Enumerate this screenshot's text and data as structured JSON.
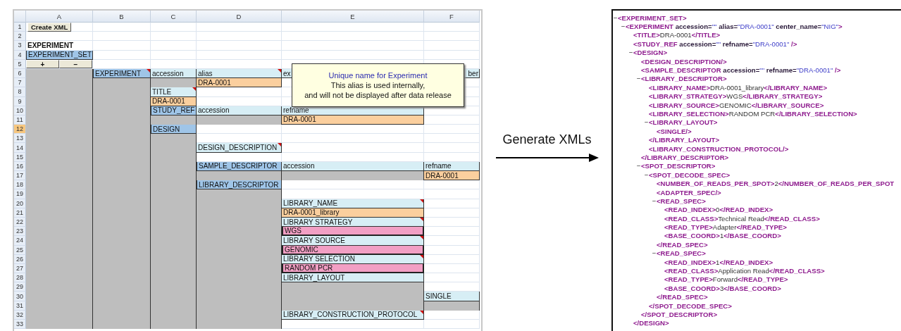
{
  "spreadsheet": {
    "columns": [
      "A",
      "B",
      "C",
      "D",
      "E",
      "F"
    ],
    "rows": [
      {
        "number": "1",
        "selected": false,
        "cells": [
          {
            "kind": "button",
            "text": "Create XML"
          },
          {
            "kind": "blank"
          },
          {
            "kind": "blank"
          },
          {
            "kind": "blank"
          },
          {
            "kind": "blank"
          },
          {
            "kind": "blank"
          }
        ]
      },
      {
        "number": "2",
        "selected": false,
        "cells": [
          {
            "kind": "blank"
          },
          {
            "kind": "blank"
          },
          {
            "kind": "blank"
          },
          {
            "kind": "blank"
          },
          {
            "kind": "blank"
          },
          {
            "kind": "blank"
          }
        ]
      },
      {
        "number": "3",
        "selected": false,
        "cells": [
          {
            "kind": "bold",
            "text": "EXPERIMENT"
          },
          {
            "kind": "blank"
          },
          {
            "kind": "blank"
          },
          {
            "kind": "blank"
          },
          {
            "kind": "blank"
          },
          {
            "kind": "blank"
          }
        ]
      },
      {
        "number": "4",
        "selected": false,
        "cells": [
          {
            "kind": "header",
            "text": "EXPERIMENT_SET",
            "comment": false
          },
          {
            "kind": "blank"
          },
          {
            "kind": "blank"
          },
          {
            "kind": "blank"
          },
          {
            "kind": "blank"
          },
          {
            "kind": "blank"
          }
        ]
      },
      {
        "number": "5",
        "selected": false,
        "cells": [
          {
            "kind": "buttons",
            "labels": [
              "+",
              "−"
            ]
          },
          {
            "kind": "blank"
          },
          {
            "kind": "blank"
          },
          {
            "kind": "blank"
          },
          {
            "kind": "blank"
          },
          {
            "kind": "blank"
          }
        ]
      },
      {
        "number": "6",
        "selected": false,
        "cells": [
          {
            "kind": "gray"
          },
          {
            "kind": "header",
            "text": "EXPERIMENT",
            "comment": true
          },
          {
            "kind": "attr",
            "text": "accession",
            "comment": false
          },
          {
            "kind": "attr",
            "text": "alias",
            "comment": true
          },
          {
            "kind": "attr",
            "text": "ex"
          },
          {
            "kind": "attr",
            "text": "ber",
            "comment": false,
            "right_aligned": true
          }
        ]
      },
      {
        "number": "7",
        "selected": false,
        "cells": [
          {
            "kind": "gray"
          },
          {
            "kind": "gray"
          },
          {
            "kind": "gray"
          },
          {
            "kind": "value",
            "text": "DRA-0001",
            "comment": false
          },
          {
            "kind": "blank"
          },
          {
            "kind": "blank"
          }
        ]
      },
      {
        "number": "8",
        "selected": false,
        "cells": [
          {
            "kind": "gray"
          },
          {
            "kind": "gray"
          },
          {
            "kind": "attr",
            "text": "TITLE",
            "comment": true
          },
          {
            "kind": "blank"
          },
          {
            "kind": "blank"
          },
          {
            "kind": "blank"
          }
        ]
      },
      {
        "number": "9",
        "selected": false,
        "cells": [
          {
            "kind": "gray"
          },
          {
            "kind": "gray"
          },
          {
            "kind": "value",
            "text": "DRA-0001",
            "comment": false
          },
          {
            "kind": "blank"
          },
          {
            "kind": "blank"
          },
          {
            "kind": "blank"
          }
        ]
      },
      {
        "number": "10",
        "selected": false,
        "cells": [
          {
            "kind": "gray"
          },
          {
            "kind": "gray"
          },
          {
            "kind": "header",
            "text": "STUDY_REF",
            "comment": false
          },
          {
            "kind": "attr",
            "text": "accession",
            "comment": false
          },
          {
            "kind": "attr",
            "text": "refname",
            "comment": false
          },
          {
            "kind": "blank"
          }
        ]
      },
      {
        "number": "11",
        "selected": false,
        "cells": [
          {
            "kind": "gray"
          },
          {
            "kind": "gray"
          },
          {
            "kind": "gray"
          },
          {
            "kind": "gray"
          },
          {
            "kind": "value",
            "text": "DRA-0001",
            "comment": false
          },
          {
            "kind": "blank"
          }
        ]
      },
      {
        "number": "12",
        "selected": true,
        "cells": [
          {
            "kind": "gray"
          },
          {
            "kind": "gray"
          },
          {
            "kind": "header",
            "text": "DESIGN",
            "comment": false
          },
          {
            "kind": "blank"
          },
          {
            "kind": "blank"
          },
          {
            "kind": "blank"
          }
        ]
      },
      {
        "number": "13",
        "selected": false,
        "cells": [
          {
            "kind": "gray"
          },
          {
            "kind": "gray"
          },
          {
            "kind": "gray"
          },
          {
            "kind": "blank"
          },
          {
            "kind": "blank"
          },
          {
            "kind": "blank"
          }
        ]
      },
      {
        "number": "14",
        "selected": false,
        "cells": [
          {
            "kind": "gray"
          },
          {
            "kind": "gray"
          },
          {
            "kind": "gray"
          },
          {
            "kind": "attr",
            "text": "DESIGN_DESCRIPTION",
            "comment": true
          },
          {
            "kind": "blank"
          },
          {
            "kind": "blank"
          }
        ]
      },
      {
        "number": "15",
        "selected": false,
        "cells": [
          {
            "kind": "gray"
          },
          {
            "kind": "gray"
          },
          {
            "kind": "gray"
          },
          {
            "kind": "blank"
          },
          {
            "kind": "blank"
          },
          {
            "kind": "blank"
          }
        ]
      },
      {
        "number": "16",
        "selected": false,
        "cells": [
          {
            "kind": "gray"
          },
          {
            "kind": "gray"
          },
          {
            "kind": "gray"
          },
          {
            "kind": "header",
            "text": "SAMPLE_DESCRIPTOR",
            "comment": false
          },
          {
            "kind": "attr",
            "text": "accession",
            "comment": false
          },
          {
            "kind": "attr",
            "text": "refname",
            "comment": false
          }
        ]
      },
      {
        "number": "17",
        "selected": false,
        "cells": [
          {
            "kind": "gray"
          },
          {
            "kind": "gray"
          },
          {
            "kind": "gray"
          },
          {
            "kind": "gray"
          },
          {
            "kind": "gray"
          },
          {
            "kind": "value",
            "text": "DRA-0001",
            "comment": false
          }
        ]
      },
      {
        "number": "18",
        "selected": false,
        "cells": [
          {
            "kind": "gray"
          },
          {
            "kind": "gray"
          },
          {
            "kind": "gray"
          },
          {
            "kind": "header",
            "text": "LIBRARY_DESCRIPTOR",
            "comment": false
          },
          {
            "kind": "blank"
          },
          {
            "kind": "blank"
          }
        ]
      },
      {
        "number": "19",
        "selected": false,
        "cells": [
          {
            "kind": "gray"
          },
          {
            "kind": "gray"
          },
          {
            "kind": "gray"
          },
          {
            "kind": "gray"
          },
          {
            "kind": "blank"
          },
          {
            "kind": "blank"
          }
        ]
      },
      {
        "number": "20",
        "selected": false,
        "cells": [
          {
            "kind": "gray"
          },
          {
            "kind": "gray"
          },
          {
            "kind": "gray"
          },
          {
            "kind": "gray"
          },
          {
            "kind": "attr",
            "text": "LIBRARY_NAME",
            "comment": true
          },
          {
            "kind": "blank"
          }
        ]
      },
      {
        "number": "21",
        "selected": false,
        "cells": [
          {
            "kind": "gray"
          },
          {
            "kind": "gray"
          },
          {
            "kind": "gray"
          },
          {
            "kind": "gray"
          },
          {
            "kind": "value",
            "text": "DRA-0001_library",
            "comment": false
          },
          {
            "kind": "blank"
          }
        ]
      },
      {
        "number": "22",
        "selected": false,
        "cells": [
          {
            "kind": "gray"
          },
          {
            "kind": "gray"
          },
          {
            "kind": "gray"
          },
          {
            "kind": "gray"
          },
          {
            "kind": "attr",
            "text": "LIBRARY STRATEGY",
            "comment": true
          },
          {
            "kind": "blank"
          }
        ]
      },
      {
        "number": "23",
        "selected": false,
        "cells": [
          {
            "kind": "gray"
          },
          {
            "kind": "gray"
          },
          {
            "kind": "gray"
          },
          {
            "kind": "gray"
          },
          {
            "kind": "choice",
            "text": "WGS",
            "comment": false
          },
          {
            "kind": "blank"
          }
        ]
      },
      {
        "number": "24",
        "selected": false,
        "cells": [
          {
            "kind": "gray"
          },
          {
            "kind": "gray"
          },
          {
            "kind": "gray"
          },
          {
            "kind": "gray"
          },
          {
            "kind": "attr",
            "text": "LIBRARY SOURCE",
            "comment": true
          },
          {
            "kind": "blank"
          }
        ]
      },
      {
        "number": "25",
        "selected": false,
        "cells": [
          {
            "kind": "gray"
          },
          {
            "kind": "gray"
          },
          {
            "kind": "gray"
          },
          {
            "kind": "gray"
          },
          {
            "kind": "choice",
            "text": "GENOMIC",
            "comment": false
          },
          {
            "kind": "blank"
          }
        ]
      },
      {
        "number": "26",
        "selected": false,
        "cells": [
          {
            "kind": "gray"
          },
          {
            "kind": "gray"
          },
          {
            "kind": "gray"
          },
          {
            "kind": "gray"
          },
          {
            "kind": "attr",
            "text": "LIBRARY SELECTION",
            "comment": true
          },
          {
            "kind": "blank"
          }
        ]
      },
      {
        "number": "27",
        "selected": false,
        "cells": [
          {
            "kind": "gray"
          },
          {
            "kind": "gray"
          },
          {
            "kind": "gray"
          },
          {
            "kind": "gray"
          },
          {
            "kind": "choice",
            "text": "RANDOM PCR",
            "comment": false
          },
          {
            "kind": "blank"
          }
        ]
      },
      {
        "number": "28",
        "selected": false,
        "cells": [
          {
            "kind": "gray"
          },
          {
            "kind": "gray"
          },
          {
            "kind": "gray"
          },
          {
            "kind": "gray"
          },
          {
            "kind": "attr",
            "text": "LIBRARY_LAYOUT",
            "comment": false
          },
          {
            "kind": "blank"
          }
        ]
      },
      {
        "number": "29",
        "selected": false,
        "cells": [
          {
            "kind": "gray"
          },
          {
            "kind": "gray"
          },
          {
            "kind": "gray"
          },
          {
            "kind": "gray"
          },
          {
            "kind": "gray"
          },
          {
            "kind": "blank"
          }
        ]
      },
      {
        "number": "30",
        "selected": false,
        "cells": [
          {
            "kind": "gray"
          },
          {
            "kind": "gray"
          },
          {
            "kind": "gray"
          },
          {
            "kind": "gray"
          },
          {
            "kind": "gray"
          },
          {
            "kind": "attr",
            "text": "SINGLE",
            "comment": false
          }
        ]
      },
      {
        "number": "31",
        "selected": false,
        "cells": [
          {
            "kind": "gray"
          },
          {
            "kind": "gray"
          },
          {
            "kind": "gray"
          },
          {
            "kind": "gray"
          },
          {
            "kind": "gray"
          },
          {
            "kind": "gray"
          }
        ]
      },
      {
        "number": "32",
        "selected": false,
        "cells": [
          {
            "kind": "gray"
          },
          {
            "kind": "gray"
          },
          {
            "kind": "gray"
          },
          {
            "kind": "gray"
          },
          {
            "kind": "attr",
            "text": "LIBRARY_CONSTRUCTION_PROTOCOL",
            "comment": true
          },
          {
            "kind": "blank"
          }
        ]
      },
      {
        "number": "33",
        "selected": false,
        "cells": [
          {
            "kind": "gray"
          },
          {
            "kind": "gray"
          },
          {
            "kind": "gray"
          },
          {
            "kind": "gray"
          },
          {
            "kind": "blank"
          },
          {
            "kind": "blank"
          }
        ]
      }
    ],
    "tooltip": {
      "title": "Unique name for Experiment",
      "lines": [
        "This alias is used internally,",
        "and will not be displayed after data release"
      ]
    }
  },
  "arrow": {
    "label": "Generate XMLs"
  },
  "xml": {
    "nodes": [
      {
        "toggle": "−",
        "line": [
          {
            "kind": "tag",
            "text": "<EXPERIMENT_SET>"
          }
        ],
        "children": [
          {
            "toggle": "−",
            "line": [
              {
                "kind": "tag",
                "text": "<EXPERIMENT"
              },
              {
                "kind": "attr",
                "text": " accession="
              },
              {
                "kind": "value",
                "text": "\"\""
              },
              {
                "kind": "attr",
                "text": " alias="
              },
              {
                "kind": "value",
                "text": "\"DRA-0001\""
              },
              {
                "kind": "attr",
                "text": " center_name="
              },
              {
                "kind": "value",
                "text": "\"NIG\""
              },
              {
                "kind": "tag",
                "text": ">"
              }
            ],
            "children": [
              {
                "line": [
                  {
                    "kind": "tag",
                    "text": "<TITLE>"
                  },
                  {
                    "kind": "content",
                    "text": "DRA-0001"
                  },
                  {
                    "kind": "tag",
                    "text": "</TITLE>"
                  }
                ]
              },
              {
                "line": [
                  {
                    "kind": "tag",
                    "text": "<STUDY_REF"
                  },
                  {
                    "kind": "attr",
                    "text": " accession="
                  },
                  {
                    "kind": "value",
                    "text": "\"\""
                  },
                  {
                    "kind": "attr",
                    "text": " refname="
                  },
                  {
                    "kind": "value",
                    "text": "\"DRA-0001\""
                  },
                  {
                    "kind": "tag",
                    "text": " />"
                  }
                ]
              },
              {
                "toggle": "−",
                "line": [
                  {
                    "kind": "tag",
                    "text": "<DESIGN>"
                  }
                ],
                "children": [
                  {
                    "line": [
                      {
                        "kind": "tag",
                        "text": "<DESIGN_DESCRIPTION/>"
                      }
                    ]
                  },
                  {
                    "line": [
                      {
                        "kind": "tag",
                        "text": "<SAMPLE_DESCRIPTOR"
                      },
                      {
                        "kind": "attr",
                        "text": " accession="
                      },
                      {
                        "kind": "value",
                        "text": "\"\""
                      },
                      {
                        "kind": "attr",
                        "text": " refname="
                      },
                      {
                        "kind": "value",
                        "text": "\"DRA-0001\""
                      },
                      {
                        "kind": "tag",
                        "text": " />"
                      }
                    ]
                  },
                  {
                    "toggle": "−",
                    "line": [
                      {
                        "kind": "tag",
                        "text": "<LIBRARY_DESCRIPTOR>"
                      }
                    ],
                    "children": [
                      {
                        "line": [
                          {
                            "kind": "tag",
                            "text": "<LIBRARY_NAME>"
                          },
                          {
                            "kind": "content",
                            "text": "DRA-0001_library"
                          },
                          {
                            "kind": "tag",
                            "text": "</LIBRARY_NAME>"
                          }
                        ]
                      },
                      {
                        "line": [
                          {
                            "kind": "tag",
                            "text": "<LIBRARY_STRATEGY>"
                          },
                          {
                            "kind": "content",
                            "text": "WGS"
                          },
                          {
                            "kind": "tag",
                            "text": "</LIBRARY_STRATEGY>"
                          }
                        ]
                      },
                      {
                        "line": [
                          {
                            "kind": "tag",
                            "text": "<LIBRARY_SOURCE>"
                          },
                          {
                            "kind": "content",
                            "text": "GENOMIC"
                          },
                          {
                            "kind": "tag",
                            "text": "</LIBRARY_SOURCE>"
                          }
                        ]
                      },
                      {
                        "line": [
                          {
                            "kind": "tag",
                            "text": "<LIBRARY_SELECTION>"
                          },
                          {
                            "kind": "content",
                            "text": "RANDOM PCR"
                          },
                          {
                            "kind": "tag",
                            "text": "</LIBRARY_SELECTION>"
                          }
                        ]
                      },
                      {
                        "toggle": "−",
                        "line": [
                          {
                            "kind": "tag",
                            "text": "<LIBRARY_LAYOUT>"
                          }
                        ],
                        "children": [
                          {
                            "line": [
                              {
                                "kind": "tag",
                                "text": "<SINGLE/>"
                              }
                            ]
                          }
                        ],
                        "close": [
                          {
                            "kind": "tag",
                            "text": "</LIBRARY_LAYOUT>"
                          }
                        ]
                      },
                      {
                        "line": [
                          {
                            "kind": "tag",
                            "text": "<LIBRARY_CONSTRUCTION_PROTOCOL/>"
                          }
                        ]
                      }
                    ],
                    "close": [
                      {
                        "kind": "tag",
                        "text": "</LIBRARY_DESCRIPTOR>"
                      }
                    ]
                  },
                  {
                    "toggle": "−",
                    "line": [
                      {
                        "kind": "tag",
                        "text": "<SPOT_DESCRIPTOR>"
                      }
                    ],
                    "children": [
                      {
                        "toggle": "−",
                        "line": [
                          {
                            "kind": "tag",
                            "text": "<SPOT_DECODE_SPEC>"
                          }
                        ],
                        "children": [
                          {
                            "line": [
                              {
                                "kind": "tag",
                                "text": "<NUMBER_OF_READS_PER_SPOT>"
                              },
                              {
                                "kind": "content",
                                "text": "2"
                              },
                              {
                                "kind": "tag",
                                "text": "</NUMBER_OF_READS_PER_SPOT"
                              }
                            ]
                          },
                          {
                            "line": [
                              {
                                "kind": "tag",
                                "text": "<ADAPTER_SPEC/>"
                              }
                            ]
                          },
                          {
                            "toggle": "−",
                            "line": [
                              {
                                "kind": "tag",
                                "text": "<READ_SPEC>"
                              }
                            ],
                            "children": [
                              {
                                "line": [
                                  {
                                    "kind": "tag",
                                    "text": "<READ_INDEX>"
                                  },
                                  {
                                    "kind": "content",
                                    "text": "0"
                                  },
                                  {
                                    "kind": "tag",
                                    "text": "</READ_INDEX>"
                                  }
                                ]
                              },
                              {
                                "line": [
                                  {
                                    "kind": "tag",
                                    "text": "<READ_CLASS>"
                                  },
                                  {
                                    "kind": "content",
                                    "text": "Technical Read"
                                  },
                                  {
                                    "kind": "tag",
                                    "text": "</READ_CLASS>"
                                  }
                                ]
                              },
                              {
                                "line": [
                                  {
                                    "kind": "tag",
                                    "text": "<READ_TYPE>"
                                  },
                                  {
                                    "kind": "content",
                                    "text": "Adapter"
                                  },
                                  {
                                    "kind": "tag",
                                    "text": "</READ_TYPE>"
                                  }
                                ]
                              },
                              {
                                "line": [
                                  {
                                    "kind": "tag",
                                    "text": "<BASE_COORD>"
                                  },
                                  {
                                    "kind": "content",
                                    "text": "1"
                                  },
                                  {
                                    "kind": "tag",
                                    "text": "</BASE_COORD>"
                                  }
                                ]
                              }
                            ],
                            "close": [
                              {
                                "kind": "tag",
                                "text": "</READ_SPEC>"
                              }
                            ]
                          },
                          {
                            "toggle": "−",
                            "line": [
                              {
                                "kind": "tag",
                                "text": "<READ_SPEC>"
                              }
                            ],
                            "children": [
                              {
                                "line": [
                                  {
                                    "kind": "tag",
                                    "text": "<READ_INDEX>"
                                  },
                                  {
                                    "kind": "content",
                                    "text": "1"
                                  },
                                  {
                                    "kind": "tag",
                                    "text": "</READ_INDEX>"
                                  }
                                ]
                              },
                              {
                                "line": [
                                  {
                                    "kind": "tag",
                                    "text": "<READ_CLASS>"
                                  },
                                  {
                                    "kind": "content",
                                    "text": "Application Read"
                                  },
                                  {
                                    "kind": "tag",
                                    "text": "</READ_CLASS>"
                                  }
                                ]
                              },
                              {
                                "line": [
                                  {
                                    "kind": "tag",
                                    "text": "<READ_TYPE>"
                                  },
                                  {
                                    "kind": "content",
                                    "text": "Forward"
                                  },
                                  {
                                    "kind": "tag",
                                    "text": "</READ_TYPE>"
                                  }
                                ]
                              },
                              {
                                "line": [
                                  {
                                    "kind": "tag",
                                    "text": "<BASE_COORD>"
                                  },
                                  {
                                    "kind": "content",
                                    "text": "3"
                                  },
                                  {
                                    "kind": "tag",
                                    "text": "</BASE_COORD>"
                                  }
                                ]
                              }
                            ],
                            "close": [
                              {
                                "kind": "tag",
                                "text": "</READ_SPEC>"
                              }
                            ]
                          }
                        ],
                        "close": [
                          {
                            "kind": "tag",
                            "text": "</SPOT_DECODE_SPEC>"
                          }
                        ]
                      }
                    ],
                    "close": [
                      {
                        "kind": "tag",
                        "text": "</SPOT_DESCRIPTOR>"
                      }
                    ]
                  }
                ],
                "close": [
                  {
                    "kind": "tag",
                    "text": "</DESIGN>"
                  }
                ]
              }
            ]
          }
        ]
      }
    ]
  }
}
